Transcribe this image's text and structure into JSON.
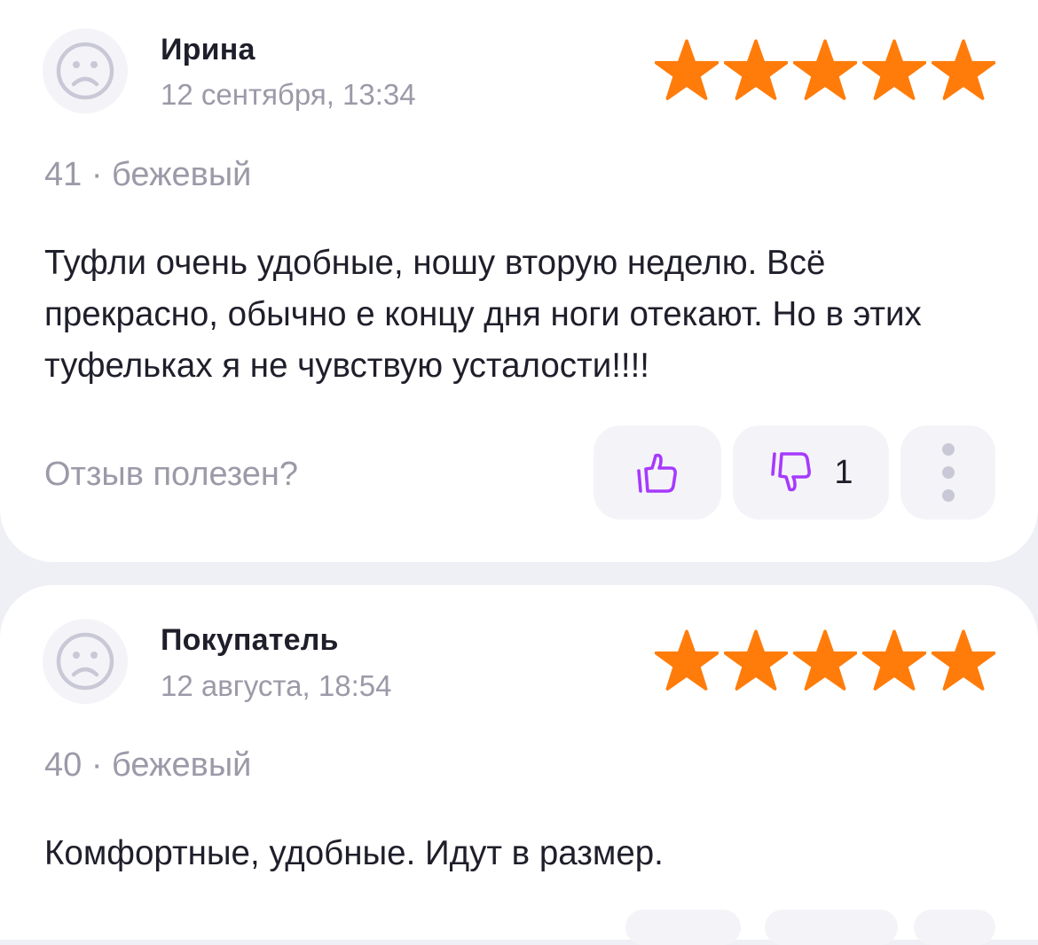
{
  "colors": {
    "star": "#ff7c0a",
    "accent_icon": "#a73afd",
    "text_primary": "#1f1f2b",
    "text_secondary": "#9b9aa8",
    "button_bg": "#f4f4f8",
    "page_bg": "#eff0f5"
  },
  "reviews": [
    {
      "author": "Ирина",
      "date": "12 сентября, 13:34",
      "rating": 5,
      "rating_max": 5,
      "variant": "41 · бежевый",
      "text": "Туфли очень удобные, ношу вторую неделю. Всё прекрасно, обычно е концу дня ноги отекают. Но в этих туфельках я не чувствую усталости!!!!",
      "helpful_question": "Отзыв полезен?",
      "dislike_count": "1"
    },
    {
      "author": "Покупатель",
      "date": "12 августа, 18:54",
      "rating": 5,
      "rating_max": 5,
      "variant": "40 · бежевый",
      "text": "Комфортные, удобные. Идут в размер."
    }
  ],
  "icons": {
    "avatar": "sad-face-icon",
    "star": "star-icon",
    "like": "thumbs-up-icon",
    "dislike": "thumbs-down-icon",
    "more": "more-vertical-icon"
  }
}
